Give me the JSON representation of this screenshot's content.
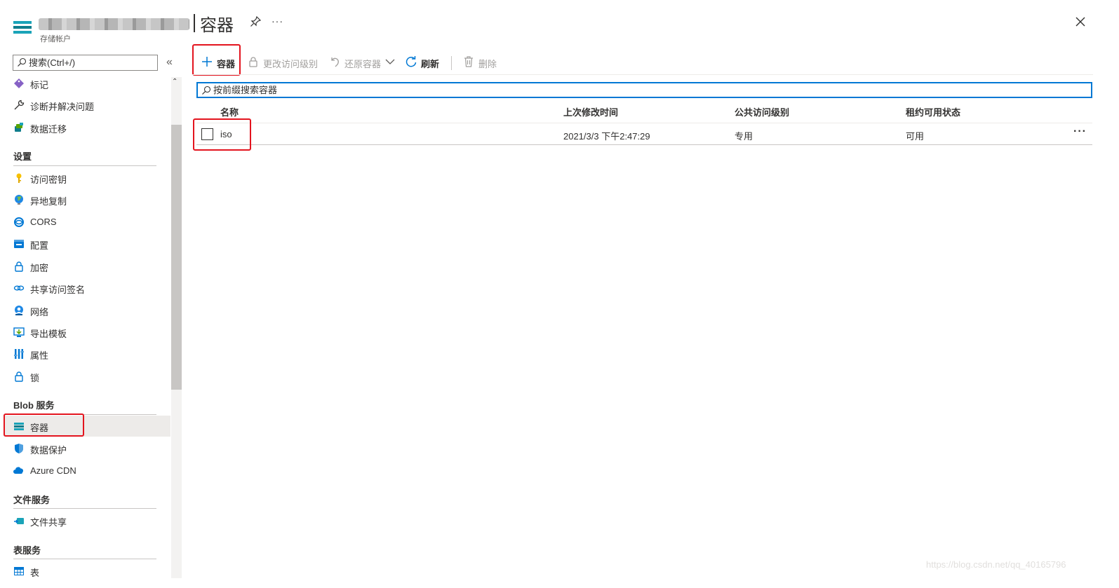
{
  "header": {
    "subtitle": "存储帐户",
    "title": "容器",
    "more": "···",
    "app_icon": "storage-containers-icon"
  },
  "sidebar": {
    "search_placeholder": "搜索(Ctrl+/)",
    "collapse": "«",
    "scroll_up": "⌃",
    "items_top": [
      {
        "label": "标记",
        "icon": "tag-icon"
      },
      {
        "label": "诊断并解决问题",
        "icon": "wrench-icon"
      },
      {
        "label": "数据迁移",
        "icon": "data-migration-icon"
      }
    ],
    "settings": {
      "header": "设置",
      "items": [
        {
          "label": "访问密钥",
          "icon": "key-icon"
        },
        {
          "label": "异地复制",
          "icon": "globe-icon"
        },
        {
          "label": "CORS",
          "icon": "cors-icon"
        },
        {
          "label": "配置",
          "icon": "configuration-icon"
        },
        {
          "label": "加密",
          "icon": "lock-icon"
        },
        {
          "label": "共享访问签名",
          "icon": "link-icon"
        },
        {
          "label": "网络",
          "icon": "network-icon"
        },
        {
          "label": "导出模板",
          "icon": "export-template-icon"
        },
        {
          "label": "属性",
          "icon": "properties-icon"
        },
        {
          "label": "锁",
          "icon": "lock-icon"
        }
      ]
    },
    "blob": {
      "header": "Blob 服务",
      "items": [
        {
          "label": "容器",
          "icon": "containers-icon",
          "selected": true
        },
        {
          "label": "数据保护",
          "icon": "shield-icon"
        },
        {
          "label": "Azure CDN",
          "icon": "cloud-icon"
        }
      ]
    },
    "files": {
      "header": "文件服务",
      "items": [
        {
          "label": "文件共享",
          "icon": "file-share-icon"
        }
      ]
    },
    "tables": {
      "header": "表服务",
      "items": [
        {
          "label": "表",
          "icon": "table-icon"
        }
      ]
    }
  },
  "toolbar": {
    "add_container": "容器",
    "change_access_level": "更改访问级别",
    "restore_containers": "还原容器",
    "refresh": "刷新",
    "delete": "删除"
  },
  "filter": {
    "placeholder": "按前缀搜索容器"
  },
  "table": {
    "columns": [
      "名称",
      "上次修改时间",
      "公共访问级别",
      "租约可用状态"
    ],
    "rows": [
      {
        "name": "iso",
        "modified": "2021/3/3 下午2:47:29",
        "access": "专用",
        "lease": "可用",
        "more": "···"
      }
    ]
  },
  "watermark": "https://blog.csdn.net/qq_40165796",
  "colors": {
    "accent": "#0078d4",
    "highlight_box": "#e3141e",
    "selected_bg": "#edebe9"
  }
}
